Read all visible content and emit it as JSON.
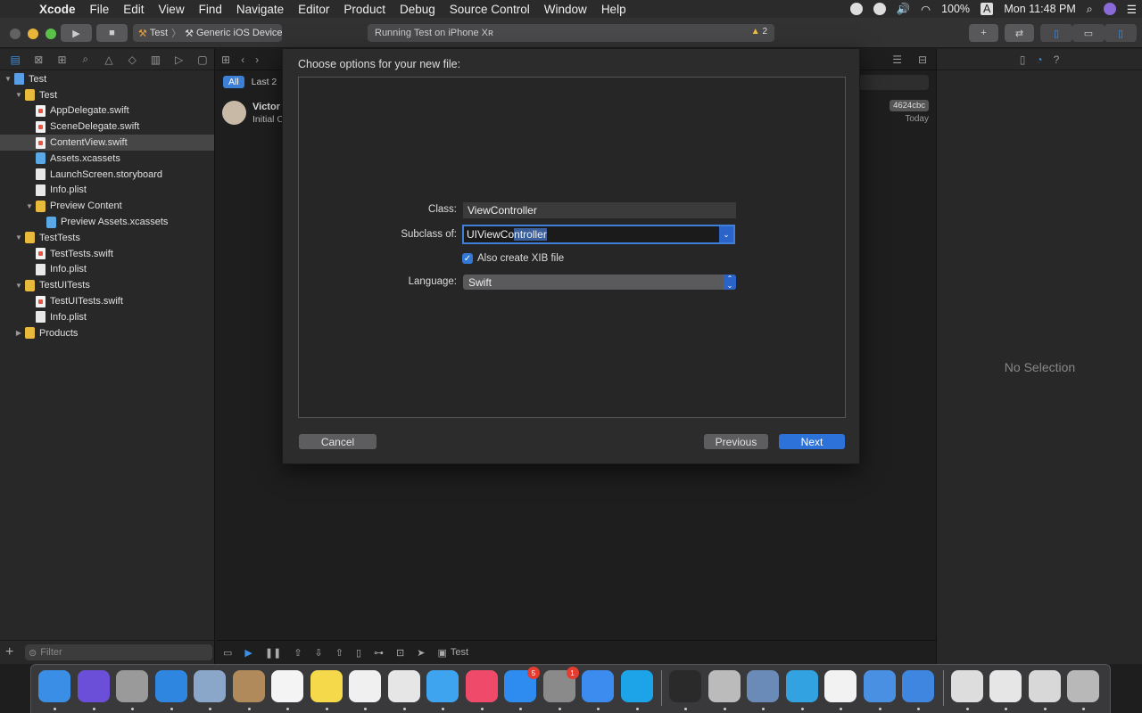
{
  "menubar": {
    "app": "Xcode",
    "items": [
      "File",
      "Edit",
      "View",
      "Find",
      "Navigate",
      "Editor",
      "Product",
      "Debug",
      "Source Control",
      "Window",
      "Help"
    ],
    "battery": "100%",
    "input": "A",
    "clock": "Mon 11:48 PM"
  },
  "toolbar": {
    "scheme": "Test",
    "destination": "Generic iOS Device",
    "activity": "Running Test on iPhone Xʀ",
    "warning_count": "2"
  },
  "navigator": {
    "tree": [
      {
        "label": "Test",
        "depth": 0,
        "icon": "project-icon",
        "disclosure": "open"
      },
      {
        "label": "Test",
        "depth": 1,
        "icon": "folder-icon",
        "disclosure": "open"
      },
      {
        "label": "AppDelegate.swift",
        "depth": 2,
        "icon": "swift-file-icon"
      },
      {
        "label": "SceneDelegate.swift",
        "depth": 2,
        "icon": "swift-file-icon"
      },
      {
        "label": "ContentView.swift",
        "depth": 2,
        "icon": "swift-file-icon",
        "selected": true
      },
      {
        "label": "Assets.xcassets",
        "depth": 2,
        "icon": "asset-folder-icon"
      },
      {
        "label": "LaunchScreen.storyboard",
        "depth": 2,
        "icon": "storyboard-icon"
      },
      {
        "label": "Info.plist",
        "depth": 2,
        "icon": "plist-icon"
      },
      {
        "label": "Preview Content",
        "depth": 2,
        "icon": "folder-icon",
        "disclosure": "open"
      },
      {
        "label": "Preview Assets.xcassets",
        "depth": 3,
        "icon": "asset-folder-icon"
      },
      {
        "label": "TestTests",
        "depth": 1,
        "icon": "folder-icon",
        "disclosure": "open"
      },
      {
        "label": "TestTests.swift",
        "depth": 2,
        "icon": "swift-file-icon"
      },
      {
        "label": "Info.plist",
        "depth": 2,
        "icon": "plist-icon"
      },
      {
        "label": "TestUITests",
        "depth": 1,
        "icon": "folder-icon",
        "disclosure": "open"
      },
      {
        "label": "TestUITests.swift",
        "depth": 2,
        "icon": "swift-file-icon"
      },
      {
        "label": "Info.plist",
        "depth": 2,
        "icon": "plist-icon"
      },
      {
        "label": "Products",
        "depth": 1,
        "icon": "folder-icon",
        "disclosure": "closed"
      }
    ],
    "filter_placeholder": "Filter"
  },
  "editor": {
    "filter_all": "All",
    "filter_last": "Last 2",
    "commit_author": "Victor",
    "commit_message": "Initial C",
    "commit_hash": "4624cbc",
    "commit_date": "Today",
    "debug_target": "Test"
  },
  "inspector": {
    "empty_label": "No Selection"
  },
  "sheet": {
    "title": "Choose options for your new file:",
    "class_label": "Class:",
    "class_value": "ViewController",
    "subclass_label": "Subclass of:",
    "subclass_typed": "UIViewCo",
    "subclass_completion": "ntroller",
    "xib_label": "Also create XIB file",
    "xib_checked": true,
    "language_label": "Language:",
    "language_value": "Swift",
    "cancel": "Cancel",
    "previous": "Previous",
    "next": "Next"
  },
  "dock": {
    "apps": [
      {
        "name": "finder-icon",
        "color": "#3a8ee6"
      },
      {
        "name": "siri-icon",
        "color": "#6b4fd8"
      },
      {
        "name": "launchpad-icon",
        "color": "#9a9a9a"
      },
      {
        "name": "safari-icon",
        "color": "#2f86e0"
      },
      {
        "name": "xcode-preview-icon",
        "color": "#8aa6c8"
      },
      {
        "name": "contacts-icon",
        "color": "#b08a5a"
      },
      {
        "name": "calendar-icon",
        "color": "#f4f4f4"
      },
      {
        "name": "notes-icon",
        "color": "#f6d94a"
      },
      {
        "name": "reminders-icon",
        "color": "#f0f0f0"
      },
      {
        "name": "photos-icon",
        "color": "#e6e6e6"
      },
      {
        "name": "messages-icon",
        "color": "#3fa4f0"
      },
      {
        "name": "music-icon",
        "color": "#f04a6a"
      },
      {
        "name": "app-store-icon",
        "color": "#2e8cf0",
        "badge": "5"
      },
      {
        "name": "system-preferences-icon",
        "color": "#8a8a8a",
        "badge": "1"
      },
      {
        "name": "xcode-icon",
        "color": "#3c8cf0"
      },
      {
        "name": "skype-icon",
        "color": "#1ca3e8"
      }
    ],
    "apps_right": [
      {
        "name": "activity-monitor-icon",
        "color": "#2a2a2a"
      },
      {
        "name": "keychain-icon",
        "color": "#bbbbbb"
      },
      {
        "name": "preview-icon",
        "color": "#6a8ab8"
      },
      {
        "name": "telegram-icon",
        "color": "#32a2e0"
      },
      {
        "name": "textedit-icon",
        "color": "#f2f2f2"
      },
      {
        "name": "instruments-icon",
        "color": "#4a90e2"
      },
      {
        "name": "simulator-icon",
        "color": "#3e86e0"
      }
    ],
    "apps_docs": [
      {
        "name": "downloads-stack-icon",
        "color": "#dddddd"
      },
      {
        "name": "document-stack-icon",
        "color": "#e6e6e6"
      },
      {
        "name": "screenshot-stack-icon",
        "color": "#d8d8d8"
      },
      {
        "name": "trash-icon",
        "color": "#b8b8b8"
      }
    ]
  }
}
